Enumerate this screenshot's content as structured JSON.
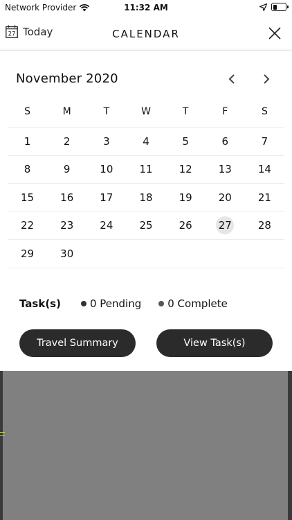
{
  "status_bar": {
    "carrier": "Network Provider",
    "time": "11:32 AM"
  },
  "header": {
    "today_label": "Today",
    "today_icon_day": "27",
    "title": "CALENDAR"
  },
  "calendar": {
    "month_label": "November 2020",
    "weekdays": [
      "S",
      "M",
      "T",
      "W",
      "T",
      "F",
      "S"
    ],
    "weeks": [
      [
        "1",
        "2",
        "3",
        "4",
        "5",
        "6",
        "7"
      ],
      [
        "8",
        "9",
        "10",
        "11",
        "12",
        "13",
        "14"
      ],
      [
        "15",
        "16",
        "17",
        "18",
        "19",
        "20",
        "21"
      ],
      [
        "22",
        "23",
        "24",
        "25",
        "26",
        "27",
        "28"
      ],
      [
        "29",
        "30",
        "",
        "",
        "",
        "",
        ""
      ]
    ],
    "selected_day": "27"
  },
  "tasks": {
    "label": "Task(s)",
    "pending": "0 Pending",
    "complete": "0 Complete"
  },
  "buttons": {
    "travel_summary": "Travel Summary",
    "view_tasks": "View Task(s)"
  },
  "colors": {
    "button_bg": "#2b2b2b",
    "selected_day_bg": "#e6e6e6",
    "backdrop": "#808080"
  }
}
